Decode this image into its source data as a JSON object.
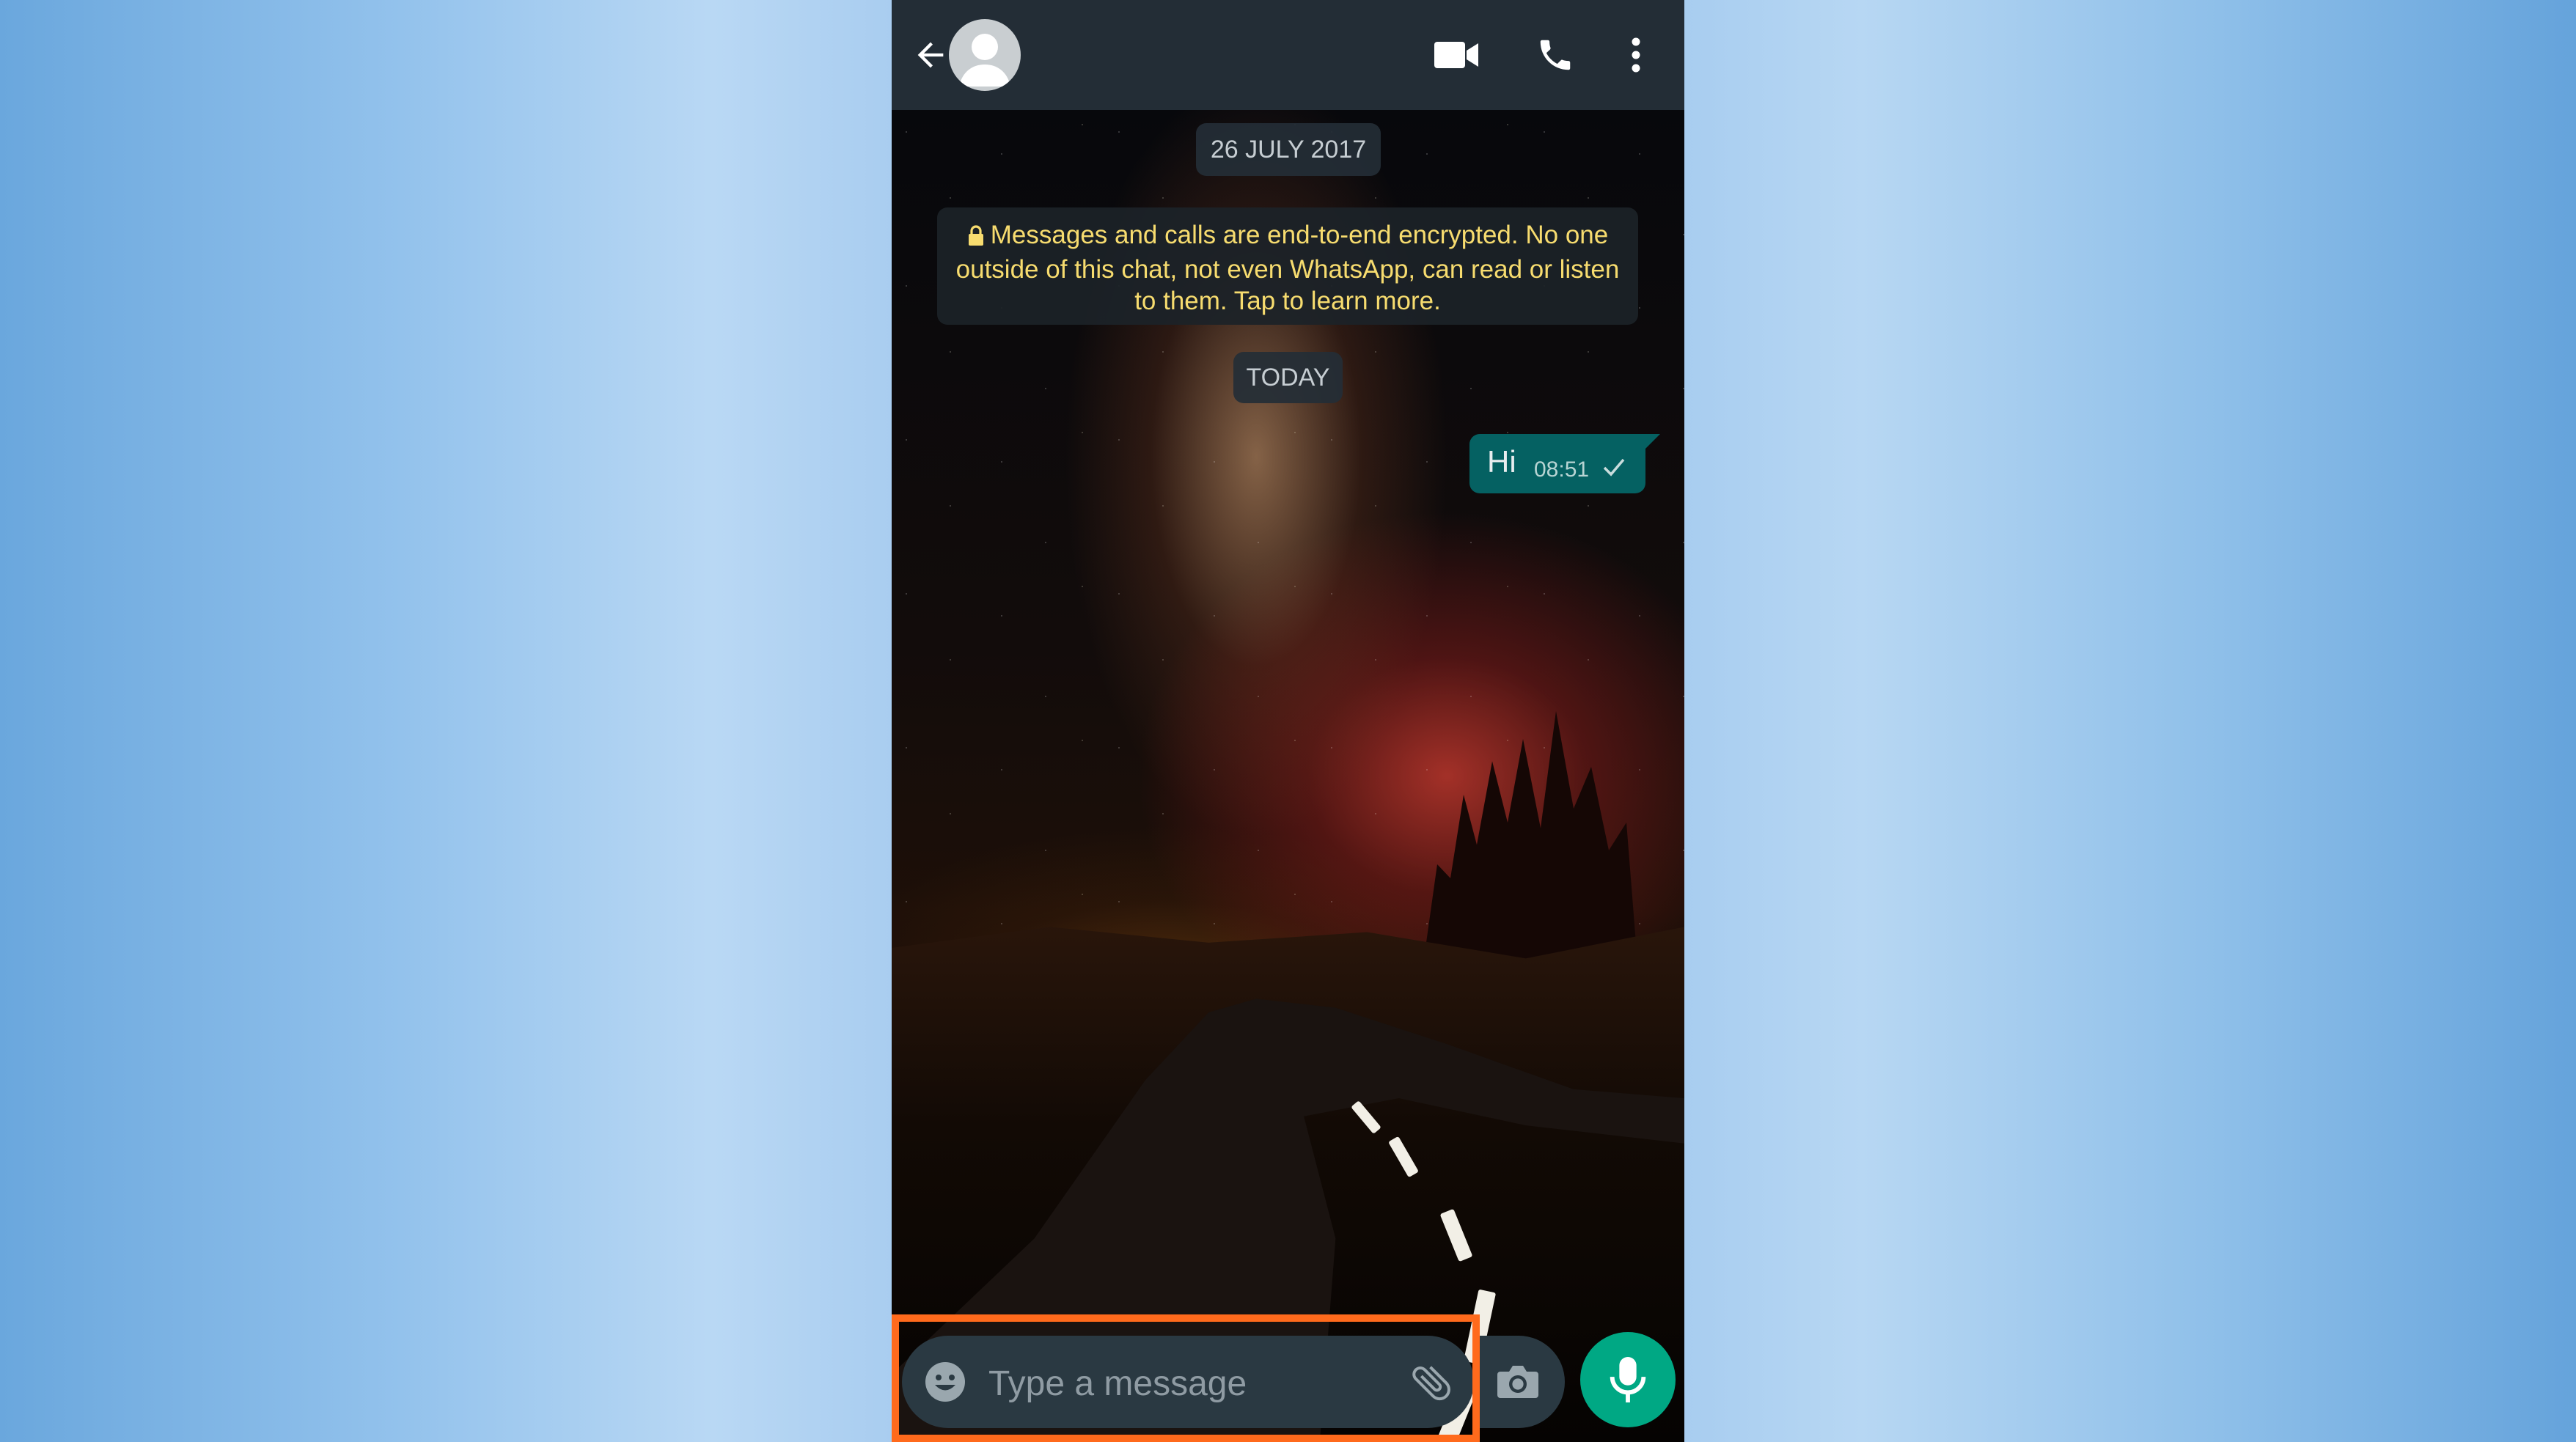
{
  "header": {
    "back_icon": "arrow-left-icon",
    "avatar_icon": "default-contact-avatar",
    "actions": [
      {
        "icon": "video-camera-icon"
      },
      {
        "icon": "phone-icon"
      },
      {
        "icon": "more-vert-icon"
      }
    ],
    "bar_color": "#232d36"
  },
  "chat": {
    "date_chip": "26 JULY 2017",
    "encryption_notice": "Messages and calls are end-to-end encrypted. No one outside of this chat, not even WhatsApp, can read or listen to them. Tap to learn more.",
    "today_chip": "TODAY",
    "messages": [
      {
        "text": "Hi",
        "time": "08:51",
        "status": "sent-single-check",
        "direction": "outgoing"
      }
    ],
    "bubble_color": "#056162",
    "notice_text_color": "#f7dc6f"
  },
  "composer": {
    "placeholder": "Type a message",
    "emoji_icon": "emoji-icon",
    "attach_icon": "paperclip-icon",
    "camera_icon": "camera-icon",
    "mic_icon": "microphone-icon",
    "mic_color": "#00a884"
  },
  "annotation": {
    "highlight_color": "#ff6a1c",
    "target": "message input field"
  }
}
